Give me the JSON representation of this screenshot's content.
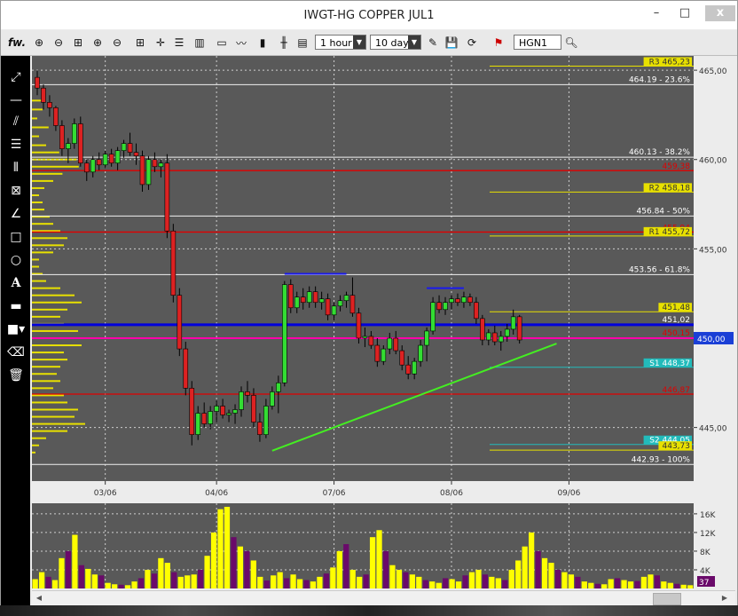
{
  "window": {
    "title": "IWGT-HG COPPER JUL1",
    "minimize_glyph": "–",
    "maximize_glyph": "□",
    "close_glyph": "x"
  },
  "toolbar": {
    "fw_label": "fw.",
    "timeframe": "1 hour",
    "period": "10 days",
    "symbol": "HGN1"
  },
  "chart_data": {
    "type": "candlestick",
    "ylim": [
      442,
      465.8
    ],
    "y_ticks": [
      445.0,
      450.0,
      455.0,
      460.0,
      465.0
    ],
    "y_tick_labels": [
      "445,00",
      "450,00",
      "455,00",
      "460,00",
      "465,00"
    ],
    "x_labels": [
      "03/06",
      "04/06",
      "07/06",
      "08/06",
      "09/06"
    ],
    "x_label_bars": [
      11,
      29,
      48,
      67,
      86
    ],
    "last_price_label": "450,00",
    "last_price": 450.0,
    "colors": {
      "bull": "#33dd33",
      "bear": "#dd2222",
      "background": "#595959",
      "fib": "#f0f0f0",
      "pivot": "#e8e000",
      "red_line": "#e00000",
      "blue_line": "#0000dd",
      "magenta_line": "#ff00aa",
      "trend": "#44ee22",
      "volume_up": "#ffff00",
      "volume_down": "#6a0a6a"
    },
    "candles": [
      [
        464.6,
        465.0,
        463.6,
        464.0
      ],
      [
        464.0,
        464.2,
        462.8,
        463.2
      ],
      [
        463.2,
        463.6,
        462.4,
        462.9
      ],
      [
        462.9,
        463.0,
        461.6,
        461.9
      ],
      [
        461.9,
        462.2,
        460.2,
        460.6
      ],
      [
        460.6,
        461.2,
        459.8,
        460.9
      ],
      [
        460.9,
        462.3,
        460.6,
        462.0
      ],
      [
        462.0,
        462.4,
        459.6,
        459.8
      ],
      [
        459.8,
        460.0,
        458.8,
        459.3
      ],
      [
        459.3,
        460.2,
        459.0,
        460.0
      ],
      [
        460.0,
        460.4,
        459.4,
        459.7
      ],
      [
        459.7,
        460.5,
        459.5,
        460.3
      ],
      [
        460.3,
        460.6,
        459.6,
        459.8
      ],
      [
        459.8,
        460.7,
        459.4,
        460.5
      ],
      [
        460.5,
        461.1,
        460.1,
        460.9
      ],
      [
        460.9,
        461.5,
        460.2,
        460.4
      ],
      [
        460.4,
        460.9,
        459.7,
        460.2
      ],
      [
        460.2,
        460.5,
        458.2,
        458.6
      ],
      [
        458.6,
        460.2,
        458.3,
        460.0
      ],
      [
        460.0,
        460.4,
        459.3,
        459.6
      ],
      [
        459.6,
        460.0,
        459.0,
        459.8
      ],
      [
        459.8,
        460.3,
        455.6,
        456.0
      ],
      [
        456.0,
        456.4,
        452.0,
        452.4
      ],
      [
        452.4,
        452.8,
        449.0,
        449.4
      ],
      [
        449.4,
        449.8,
        446.8,
        447.2
      ],
      [
        447.2,
        447.6,
        444.0,
        444.6
      ],
      [
        444.6,
        446.2,
        444.3,
        445.8
      ],
      [
        445.8,
        446.4,
        445.0,
        445.2
      ],
      [
        445.2,
        446.2,
        444.9,
        445.9
      ],
      [
        445.9,
        446.5,
        445.3,
        446.2
      ],
      [
        446.2,
        446.6,
        445.5,
        445.7
      ],
      [
        445.7,
        446.0,
        445.3,
        445.8
      ],
      [
        445.8,
        446.3,
        445.2,
        446.0
      ],
      [
        446.0,
        447.3,
        445.6,
        447.0
      ],
      [
        447.0,
        447.6,
        446.4,
        446.8
      ],
      [
        446.8,
        447.2,
        445.0,
        445.3
      ],
      [
        445.3,
        445.8,
        444.2,
        444.6
      ],
      [
        444.6,
        446.6,
        444.4,
        446.2
      ],
      [
        446.2,
        447.3,
        446.0,
        447.0
      ],
      [
        447.0,
        447.9,
        445.8,
        447.5
      ],
      [
        447.5,
        453.2,
        447.3,
        453.0
      ],
      [
        453.0,
        453.3,
        451.4,
        451.7
      ],
      [
        451.7,
        452.6,
        451.4,
        452.3
      ],
      [
        452.3,
        452.8,
        451.6,
        452.0
      ],
      [
        452.0,
        452.9,
        451.7,
        452.6
      ],
      [
        452.6,
        452.9,
        451.7,
        452.0
      ],
      [
        452.0,
        452.6,
        451.6,
        452.2
      ],
      [
        452.2,
        452.5,
        451.0,
        451.3
      ],
      [
        451.3,
        452.0,
        451.0,
        451.8
      ],
      [
        451.8,
        452.4,
        451.5,
        452.1
      ],
      [
        452.1,
        452.6,
        451.7,
        452.4
      ],
      [
        452.4,
        453.4,
        451.2,
        451.4
      ],
      [
        451.4,
        451.7,
        449.7,
        450.0
      ],
      [
        450.0,
        450.6,
        449.5,
        450.1
      ],
      [
        450.1,
        450.4,
        449.4,
        449.6
      ],
      [
        449.6,
        450.0,
        448.4,
        448.7
      ],
      [
        448.7,
        449.6,
        448.5,
        449.4
      ],
      [
        449.4,
        450.3,
        449.1,
        450.0
      ],
      [
        450.0,
        450.4,
        449.1,
        449.3
      ],
      [
        449.3,
        449.6,
        448.2,
        448.5
      ],
      [
        448.5,
        449.0,
        447.7,
        448.0
      ],
      [
        448.0,
        448.9,
        447.7,
        448.7
      ],
      [
        448.7,
        449.9,
        448.4,
        449.6
      ],
      [
        449.6,
        450.6,
        448.7,
        450.4
      ],
      [
        450.4,
        452.3,
        450.2,
        452.0
      ],
      [
        452.0,
        452.4,
        451.4,
        451.6
      ],
      [
        451.6,
        452.3,
        451.3,
        452.0
      ],
      [
        452.0,
        452.4,
        451.6,
        452.2
      ],
      [
        452.2,
        452.5,
        451.8,
        452.0
      ],
      [
        452.0,
        452.6,
        451.7,
        452.3
      ],
      [
        452.3,
        452.5,
        451.8,
        452.0
      ],
      [
        452.0,
        452.3,
        450.8,
        451.1
      ],
      [
        451.1,
        451.3,
        449.6,
        449.9
      ],
      [
        449.9,
        450.5,
        449.6,
        450.3
      ],
      [
        450.3,
        450.7,
        449.6,
        449.8
      ],
      [
        449.8,
        450.4,
        449.3,
        450.1
      ],
      [
        450.1,
        450.8,
        449.8,
        450.5
      ],
      [
        450.5,
        451.6,
        450.2,
        451.2
      ],
      [
        451.2,
        451.3,
        449.7,
        449.9
      ]
    ],
    "volume_max_label": "16K",
    "volume_ticks": [
      16000,
      12000,
      8000,
      4000
    ],
    "volume_tick_labels": [
      "16K",
      "12K",
      "8K",
      "4K"
    ],
    "volume_current_label": "37",
    "volume_ylim": [
      0,
      17500
    ],
    "volume": [
      [
        2000,
        1
      ],
      [
        3500,
        1
      ],
      [
        2500,
        0
      ],
      [
        1800,
        1
      ],
      [
        6500,
        1
      ],
      [
        8000,
        0
      ],
      [
        11500,
        1
      ],
      [
        5000,
        0
      ],
      [
        4200,
        1
      ],
      [
        3000,
        1
      ],
      [
        2800,
        0
      ],
      [
        1200,
        1
      ],
      [
        900,
        1
      ],
      [
        800,
        0
      ],
      [
        700,
        1
      ],
      [
        1500,
        1
      ],
      [
        2200,
        0
      ],
      [
        4000,
        1
      ],
      [
        3200,
        0
      ],
      [
        6500,
        1
      ],
      [
        5500,
        1
      ],
      [
        3500,
        0
      ],
      [
        2500,
        1
      ],
      [
        2800,
        1
      ],
      [
        3000,
        1
      ],
      [
        4000,
        0
      ],
      [
        7000,
        1
      ],
      [
        12000,
        1
      ],
      [
        17000,
        1
      ],
      [
        17500,
        1
      ],
      [
        11000,
        0
      ],
      [
        9000,
        1
      ],
      [
        8000,
        0
      ],
      [
        6000,
        1
      ],
      [
        2500,
        1
      ],
      [
        1700,
        0
      ],
      [
        2800,
        1
      ],
      [
        3500,
        1
      ],
      [
        2200,
        0
      ],
      [
        3000,
        1
      ],
      [
        2000,
        1
      ],
      [
        1800,
        0
      ],
      [
        1500,
        1
      ],
      [
        2500,
        1
      ],
      [
        3200,
        0
      ],
      [
        4500,
        1
      ],
      [
        8000,
        1
      ],
      [
        9500,
        0
      ],
      [
        4000,
        1
      ],
      [
        2500,
        1
      ],
      [
        3000,
        0
      ],
      [
        11000,
        1
      ],
      [
        12500,
        1
      ],
      [
        8000,
        0
      ],
      [
        5000,
        1
      ],
      [
        4000,
        1
      ],
      [
        3500,
        0
      ],
      [
        3000,
        1
      ],
      [
        2500,
        1
      ],
      [
        1800,
        0
      ],
      [
        1500,
        1
      ],
      [
        1200,
        1
      ],
      [
        2200,
        0
      ],
      [
        2000,
        1
      ],
      [
        1500,
        1
      ],
      [
        2800,
        0
      ],
      [
        3500,
        1
      ],
      [
        4000,
        1
      ],
      [
        3000,
        0
      ],
      [
        2500,
        1
      ],
      [
        2200,
        1
      ],
      [
        1800,
        0
      ],
      [
        4000,
        1
      ],
      [
        6000,
        1
      ],
      [
        9000,
        1
      ],
      [
        12000,
        1
      ],
      [
        8000,
        0
      ],
      [
        6500,
        1
      ],
      [
        5500,
        1
      ],
      [
        4000,
        0
      ],
      [
        3500,
        1
      ],
      [
        3000,
        1
      ],
      [
        2500,
        0
      ],
      [
        1500,
        1
      ],
      [
        1200,
        1
      ],
      [
        1000,
        0
      ],
      [
        900,
        1
      ],
      [
        2000,
        1
      ],
      [
        2200,
        0
      ],
      [
        1800,
        1
      ],
      [
        1500,
        1
      ],
      [
        1600,
        0
      ],
      [
        2500,
        1
      ],
      [
        3000,
        1
      ],
      [
        2800,
        0
      ],
      [
        1500,
        1
      ],
      [
        1200,
        1
      ],
      [
        1000,
        0
      ],
      [
        800,
        1
      ],
      [
        700,
        1
      ]
    ],
    "volume_profile": [
      [
        463.3,
        2.6
      ],
      [
        462.8,
        3.0
      ],
      [
        462.3,
        1.5
      ],
      [
        461.8,
        4.7
      ],
      [
        461.3,
        2.0
      ],
      [
        460.8,
        4.0
      ],
      [
        460.4,
        7.7
      ],
      [
        460.0,
        12.6
      ],
      [
        459.6,
        13.2
      ],
      [
        459.2,
        8.6
      ],
      [
        458.8,
        6.0
      ],
      [
        458.4,
        3.5
      ],
      [
        458.0,
        2.0
      ],
      [
        457.6,
        3.0
      ],
      [
        457.2,
        3.5
      ],
      [
        456.8,
        5.0
      ],
      [
        456.4,
        6.0
      ],
      [
        456.0,
        8.0
      ],
      [
        455.6,
        10.0
      ],
      [
        455.2,
        9.0
      ],
      [
        454.8,
        6.0
      ],
      [
        454.4,
        2.0
      ],
      [
        454.0,
        2.0
      ],
      [
        453.6,
        3.0
      ],
      [
        453.2,
        4.0
      ],
      [
        452.8,
        8.0
      ],
      [
        452.4,
        12.0
      ],
      [
        452.0,
        14.0
      ],
      [
        451.6,
        10.0
      ],
      [
        451.2,
        8.0
      ],
      [
        450.8,
        9.0
      ],
      [
        450.4,
        13.0
      ],
      [
        450.0,
        19.0
      ],
      [
        449.6,
        14.0
      ],
      [
        449.2,
        9.0
      ],
      [
        448.8,
        10.0
      ],
      [
        448.4,
        8.0
      ],
      [
        448.0,
        7.0
      ],
      [
        447.6,
        8.0
      ],
      [
        447.2,
        6.0
      ],
      [
        446.8,
        9.0
      ],
      [
        446.4,
        10.0
      ],
      [
        446.0,
        13.0
      ],
      [
        445.6,
        12.0
      ],
      [
        445.2,
        15.0
      ],
      [
        444.8,
        10.0
      ],
      [
        444.4,
        4.0
      ],
      [
        444.0,
        2.0
      ],
      [
        443.6,
        1.0
      ]
    ],
    "fib_levels": [
      {
        "price": 464.19,
        "label": "464.19 - 23.6%"
      },
      {
        "price": 460.13,
        "label": "460.13 - 38.2%"
      },
      {
        "price": 456.84,
        "label": "456.84 - 50%"
      },
      {
        "price": 453.56,
        "label": "453.56 - 61.8%"
      },
      {
        "price": 442.93,
        "label": "442.93 - 100%"
      }
    ],
    "pivot_levels": [
      {
        "price": 465.23,
        "label": "R3 465,23",
        "type": "pivot"
      },
      {
        "price": 458.18,
        "label": "R2 458,18",
        "type": "pivot"
      },
      {
        "price": 455.72,
        "label": "R1 455,72",
        "type": "pivot"
      },
      {
        "price": 451.48,
        "label": "451,48",
        "type": "pivot"
      },
      {
        "price": 448.37,
        "label": "S1 448,37",
        "type": "support"
      },
      {
        "price": 444.05,
        "label": "S2 444,05",
        "type": "support"
      },
      {
        "price": 443.73,
        "label": "443,73",
        "type": "pivot"
      }
    ],
    "red_lines": [
      {
        "price": 459.38,
        "label": "459,38"
      },
      {
        "price": 455.94,
        "label": "455,94"
      },
      {
        "price": 446.87,
        "label": "446,87"
      }
    ],
    "blue_line": {
      "price": 450.75,
      "label": "451,02"
    },
    "magenta_line": {
      "price": 450.0,
      "label": "450,15"
    },
    "resistance_tops": [
      {
        "from": 40,
        "to": 50,
        "price": 453.6
      },
      {
        "from": 63,
        "to": 69,
        "price": 452.8
      }
    ],
    "trend_line": {
      "from": [
        38,
        443.7
      ],
      "to": [
        84,
        449.7
      ]
    }
  }
}
